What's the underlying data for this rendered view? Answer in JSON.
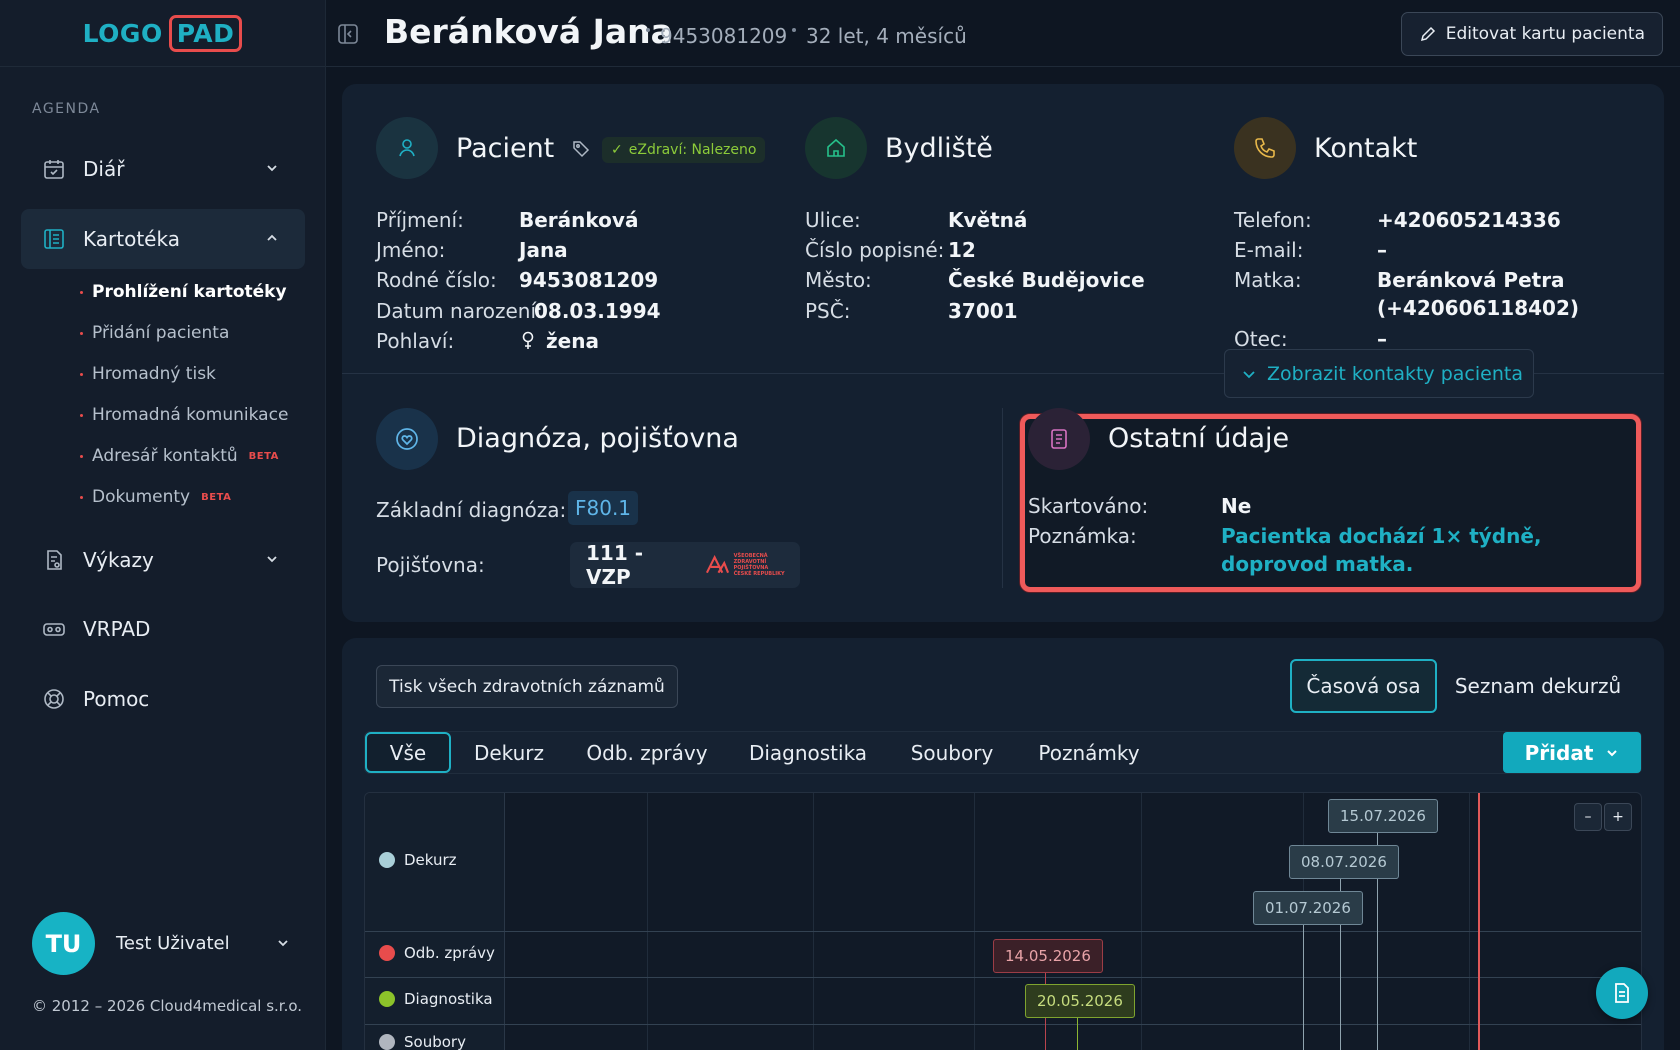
{
  "brand": {
    "logo_part1": "LOGO",
    "logo_part2": "PAD",
    "accent": "#1fb0c4",
    "alert": "#e84c4c"
  },
  "sidebar": {
    "section_label": "AGENDA",
    "items": [
      {
        "label": "Diář",
        "icon": "calendar-check-icon"
      },
      {
        "label": "Kartotéka",
        "icon": "card-file-icon",
        "expanded": true
      },
      {
        "label": "Výkazy",
        "icon": "report-icon"
      },
      {
        "label": "VRPAD",
        "icon": "vr-headset-icon"
      },
      {
        "label": "Pomoc",
        "icon": "lifebuoy-icon"
      }
    ],
    "sub_items": [
      {
        "label": "Prohlížení kartotéky",
        "current": true
      },
      {
        "label": "Přidání pacienta"
      },
      {
        "label": "Hromadný tisk"
      },
      {
        "label": "Hromadná komunikace"
      },
      {
        "label": "Adresář kontaktů",
        "badge": "BETA"
      },
      {
        "label": "Dokumenty",
        "badge": "BETA"
      }
    ],
    "user": {
      "initials": "TU",
      "name": "Test Uživatel"
    },
    "copyright": "© 2012 – 2026 Cloud4medical s.r.o."
  },
  "header": {
    "patient_name": "Beránková Jana",
    "birth_number": "9453081209",
    "age": "32 let, 4 měsíců",
    "edit_label": "Editovat kartu pacienta"
  },
  "patient": {
    "title": "Pacient",
    "ezdravi_badge": "eZdraví: Nalezeno",
    "fields": [
      {
        "label": "Příjmení:",
        "value": "Beránková"
      },
      {
        "label": "Jméno:",
        "value": "Jana"
      },
      {
        "label": "Rodné číslo:",
        "value": "9453081209"
      },
      {
        "label": "Datum narození:",
        "value": "08.03.1994"
      },
      {
        "label": "Pohlaví:",
        "value": "žena"
      }
    ]
  },
  "residence": {
    "title": "Bydliště",
    "fields": [
      {
        "label": "Ulice:",
        "value": "Květná"
      },
      {
        "label": "Číslo popisné:",
        "value": "12"
      },
      {
        "label": "Město:",
        "value": "České Budějovice"
      },
      {
        "label": "PSČ:",
        "value": "37001"
      }
    ]
  },
  "contact": {
    "title": "Kontakt",
    "fields": [
      {
        "label": "Telefon:",
        "value": "+420605214336"
      },
      {
        "label": "E-mail:",
        "value": "–"
      },
      {
        "label": "Matka:",
        "value": "Beránková Petra",
        "value2": "(+420606118402)"
      },
      {
        "label": "Otec:",
        "value": "–"
      }
    ],
    "show_contacts_label": "Zobrazit kontakty pacienta"
  },
  "diagnosis": {
    "title": "Diagnóza, pojišťovna",
    "base_label": "Základní diagnóza:",
    "base_code": "F80.1",
    "insurer_label": "Pojišťovna:",
    "insurer_value": "111 - VZP",
    "insurer_logo_text": [
      "VŠEOBECNÁ",
      "ZDRAVOTNÍ POJIŠŤOVNA",
      "ČESKÉ REPUBLIKY"
    ]
  },
  "other": {
    "title": "Ostatní údaje",
    "shredded_label": "Skartováno:",
    "shredded_value": "Ne",
    "note_label": "Poznámka:",
    "note_value": "Pacientka dochází 1× týdně, doprovod matka."
  },
  "records": {
    "print_all_label": "Tisk všech zdravotních záznamů",
    "view_timeline": "Časová osa",
    "view_list": "Seznam dekurzů",
    "filters": [
      "Vše",
      "Dekurz",
      "Odb. zprávy",
      "Diagnostika",
      "Soubory",
      "Poznámky"
    ],
    "active_filter": "Vše",
    "add_label": "Přidat"
  },
  "timeline": {
    "rows": [
      {
        "label": "Dekurz",
        "color": "#a9cfd8"
      },
      {
        "label": "Odb. zprávy",
        "color": "#e84c4c"
      },
      {
        "label": "Diagnostika",
        "color": "#8cc32a"
      },
      {
        "label": "Soubory",
        "color": "#b0b6bf"
      }
    ],
    "events": [
      {
        "row": "Dekurz",
        "date": "15.07.2026"
      },
      {
        "row": "Dekurz",
        "date": "08.07.2026"
      },
      {
        "row": "Dekurz",
        "date": "01.07.2026"
      },
      {
        "row": "Odb. zprávy",
        "date": "14.05.2026"
      },
      {
        "row": "Diagnostika",
        "date": "20.05.2026"
      }
    ],
    "zoom_out": "–",
    "zoom_in": "+"
  }
}
